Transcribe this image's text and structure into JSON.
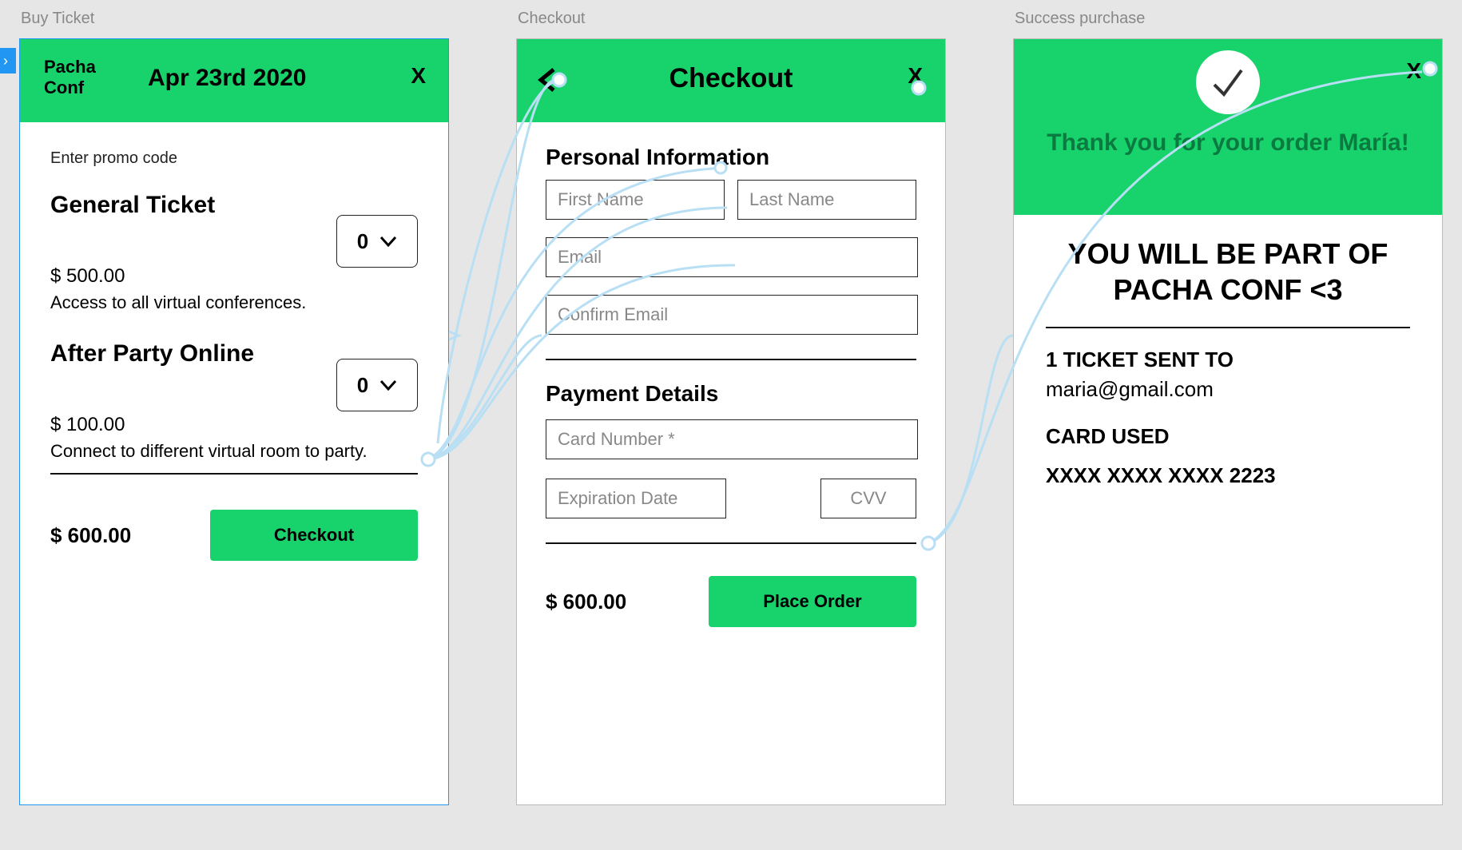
{
  "labels": {
    "buy": "Buy Ticket",
    "checkout": "Checkout",
    "success": "Success purchase"
  },
  "buy": {
    "brand": "Pacha Conf",
    "date": "Apr 23rd 2020",
    "close": "X",
    "promo": "Enter promo code",
    "ticket1_title": "General Ticket",
    "ticket1_qty": "0",
    "ticket1_price": "$ 500.00",
    "ticket1_desc": "Access to all virtual conferences.",
    "ticket2_title": "After Party Online",
    "ticket2_qty": "0",
    "ticket2_price": "$ 100.00",
    "ticket2_desc": "Connect to different virtual room to party.",
    "total": "$ 600.00",
    "checkout_btn": "Checkout"
  },
  "checkout": {
    "title": "Checkout",
    "close": "X",
    "personal": "Personal Information",
    "first": "First Name",
    "last": "Last Name",
    "email": "Email",
    "confirm": "Confirm Email",
    "payment": "Payment Details",
    "card": "Card Number *",
    "exp": "Expiration Date",
    "cvv": "CVV",
    "total": "$ 600.00",
    "place": "Place Order"
  },
  "success": {
    "close": "X",
    "thanks": "Thank you for your order María!",
    "headline": "YOU WILL BE PART OF\nPACHA CONF <3",
    "sent_label": "1 TICKET SENT TO",
    "sent_email": "maria@gmail.com",
    "card_label": "CARD USED",
    "card_masked": "XXXX XXXX XXXX 2223"
  }
}
